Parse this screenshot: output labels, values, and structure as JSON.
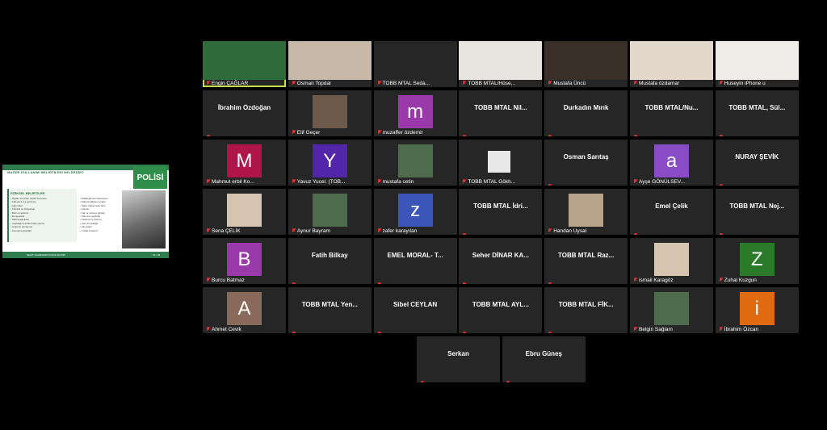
{
  "shared_screen": {
    "heading": "MADDE KULLANIMI BELİRTİLERİ NELERDİR?",
    "logo_text": "POLİSİ",
    "box_title": "FİZİKSEL BELİRTİLER",
    "list_left": [
      "Öğüde sorunlar, ölçülü seçmeler",
      "Kabulene dış görünüş",
      "Ağız kilavı",
      "Kilitrelik ve dolgunluk",
      "Burnun akıntısı",
      "Dengesizlik",
      "Sarfosyala kadl",
      "Uzaklaşma anlamında eyleme",
      "Güçlerin tamlanma",
      "Konuşma güçlüğü"
    ],
    "list_right": [
      "Nilükleğimsel sekresiyon",
      "Kabul bağlanış yeralar",
      "Sakız çiğnemede artış",
      "Kaşıntı",
      "Kar ve sözeve ağrıları",
      "Solunum güçlüğü",
      "Tarlama ve titreme",
      "Uçlu kemekliğe",
      "Kilo kaybı",
      "Yüzde kızarma"
    ],
    "footer_text": "ŞEHİT KAHRAMAN POLİS DİLİNİN",
    "page_number": "15 / 40"
  },
  "participants": [
    {
      "label": "Engin ÇAĞLAR",
      "kind": "video",
      "active": true
    },
    {
      "label": "Osman Topdal",
      "kind": "video"
    },
    {
      "label": "TOBB MTAL Seda...",
      "kind": "empty"
    },
    {
      "label": "TOBB MTAL/Hüse...",
      "kind": "video"
    },
    {
      "label": "Mustafa Üncü",
      "kind": "video"
    },
    {
      "label": "Mustafa özdamar",
      "kind": "video"
    },
    {
      "label": "Huseyin iPhone u",
      "kind": "video"
    },
    {
      "name": "İbrahim Özdoğan",
      "kind": "name"
    },
    {
      "label": "Elif Geçer",
      "kind": "thumb"
    },
    {
      "label": "muzaffer özdemir",
      "kind": "avatar",
      "letter": "m",
      "color": "#9a3aaa"
    },
    {
      "name": "TOBB MTAL Nil...",
      "kind": "name"
    },
    {
      "name": "Durkadın Mırık",
      "kind": "name"
    },
    {
      "name": "TOBB MTAL/Nu...",
      "kind": "name"
    },
    {
      "name": "TOBB MTAL, Sül...",
      "kind": "name"
    },
    {
      "label": "Mahmut erbil Ko...",
      "kind": "avatar",
      "letter": "M",
      "color": "#b0154a"
    },
    {
      "label": "Yavuz Yucel. (TOB...",
      "kind": "avatar",
      "letter": "Y",
      "color": "#5226a8"
    },
    {
      "label": "mustafa cetin",
      "kind": "thumb"
    },
    {
      "label": "TOBB MTAL Gökh...",
      "kind": "blank"
    },
    {
      "name": "Osman Sarıtaş",
      "kind": "name"
    },
    {
      "label": "Ayşe GÖNÜLSEV...",
      "kind": "avatar",
      "letter": "a",
      "color": "#8a4bc6"
    },
    {
      "name": "NURAY ŞEVİK",
      "kind": "name"
    },
    {
      "label": "Sena ÇELİK",
      "kind": "thumb"
    },
    {
      "label": "Aynur Bayram",
      "kind": "thumb"
    },
    {
      "label": "zafer karayılan",
      "kind": "avatar",
      "letter": "z",
      "color": "#3b56b8"
    },
    {
      "name": "TOBB MTAL İdri...",
      "kind": "name"
    },
    {
      "label": "Handan Uysal",
      "kind": "thumb"
    },
    {
      "name": "Emel Çelik",
      "kind": "name"
    },
    {
      "name": "TOBB MTAL Nej...",
      "kind": "name"
    },
    {
      "label": "Burcu Batmaz",
      "kind": "avatar",
      "letter": "B",
      "color": "#9a3aaa"
    },
    {
      "name": "Fatih Bilkay",
      "kind": "name"
    },
    {
      "name": "EMEL MORAL- T...",
      "kind": "name"
    },
    {
      "name": "Seher DİNAR KA...",
      "kind": "name"
    },
    {
      "name": "TOBB MTAL Raz...",
      "kind": "name"
    },
    {
      "label": "ismail Karagöz",
      "kind": "thumb"
    },
    {
      "label": "Zuhal Kuzgun",
      "kind": "avatar",
      "letter": "Z",
      "color": "#2a7a2a"
    },
    {
      "label": "Ahmet Cevik",
      "kind": "avatar",
      "letter": "A",
      "color": "#8a6a5a"
    },
    {
      "name": "TOBB MTAL Yen...",
      "kind": "name"
    },
    {
      "name": "Sibel CEYLAN",
      "kind": "name"
    },
    {
      "name": "TOBB MTAL AYL...",
      "kind": "name"
    },
    {
      "name": "TOBB MTAL FİK...",
      "kind": "name"
    },
    {
      "label": "Belgin Sağlam",
      "kind": "thumb"
    },
    {
      "label": "İbrahim Özcan",
      "kind": "avatar",
      "letter": "i",
      "color": "#e06a10"
    },
    {
      "name": "Serkan",
      "kind": "name"
    },
    {
      "name": "Ebru Güneş",
      "kind": "name"
    }
  ]
}
